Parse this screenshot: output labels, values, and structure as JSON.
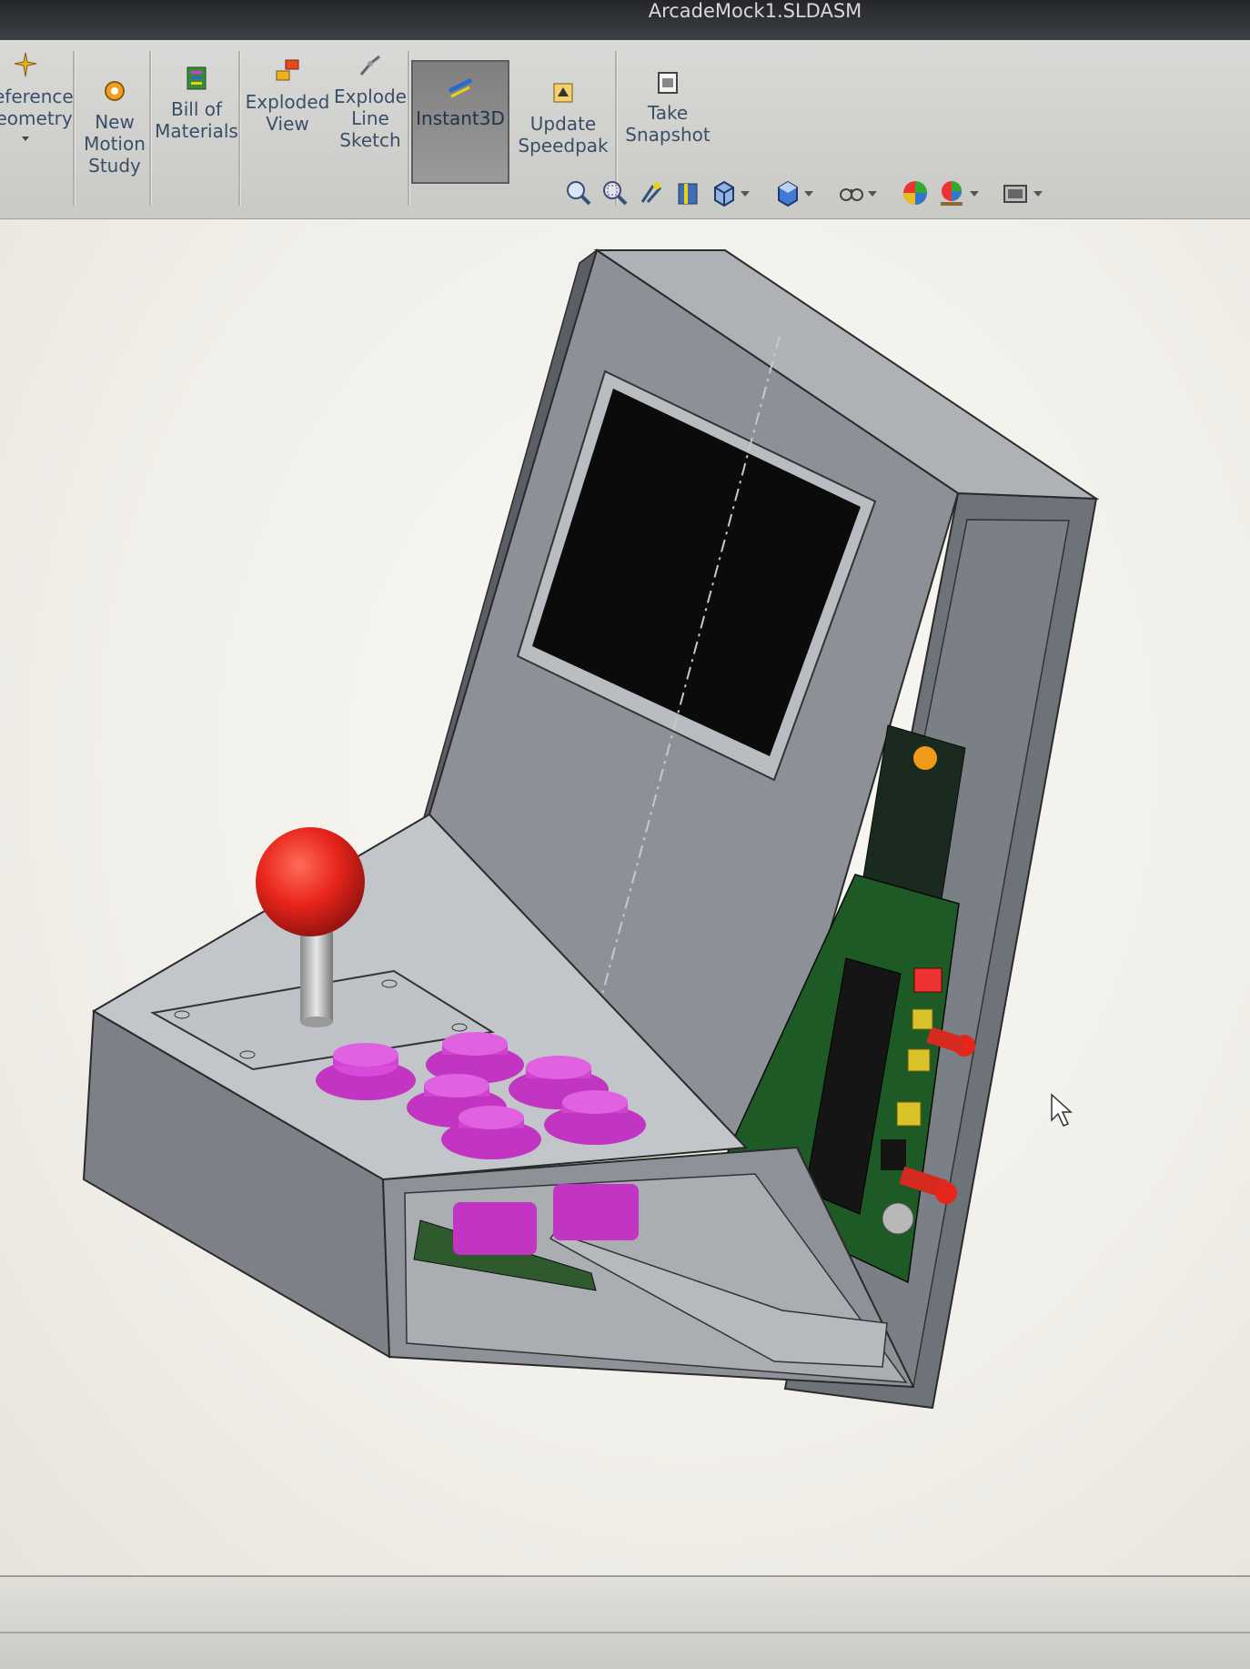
{
  "window": {
    "title": "ArcadeMock1.SLDASM"
  },
  "ribbon": {
    "buttons": [
      {
        "id": "reference-geometry",
        "label": "Reference\nGeometry",
        "icon": "reference-geometry-icon"
      },
      {
        "id": "new-motion-study",
        "label": "New\nMotion\nStudy",
        "icon": "motion-study-icon"
      },
      {
        "id": "bill-of-materials",
        "label": "Bill of\nMaterials",
        "icon": "bill-of-materials-icon"
      },
      {
        "id": "exploded-view",
        "label": "Exploded\nView",
        "icon": "exploded-view-icon"
      },
      {
        "id": "explode-line-sketch",
        "label": "Explode\nLine\nSketch",
        "icon": "explode-line-sketch-icon"
      },
      {
        "id": "instant3d",
        "label": "Instant3D",
        "icon": "instant3d-icon",
        "active": true
      },
      {
        "id": "update-speedpak",
        "label": "Update\nSpeedpak",
        "icon": "speedpak-icon"
      },
      {
        "id": "take-snapshot",
        "label": "Take\nSnapshot",
        "icon": "snapshot-icon"
      }
    ]
  },
  "view_toolbar": [
    "zoom-to-fit-icon",
    "zoom-to-area-icon",
    "previous-view-icon",
    "section-view-icon",
    "view-orientation-icon",
    "display-style-icon",
    "hide-show-items-icon",
    "edit-appearance-icon",
    "apply-scene-icon",
    "view-settings-icon"
  ],
  "model": {
    "name": "arcade-cabinet-assembly",
    "colors": {
      "body": "#8a8e94",
      "body_dark": "#6b6f75",
      "screen": "#0b0b0c",
      "joystick_ball": "#e8251b",
      "buttons": "#d43bd3",
      "pcb": "#1d5a26"
    }
  }
}
